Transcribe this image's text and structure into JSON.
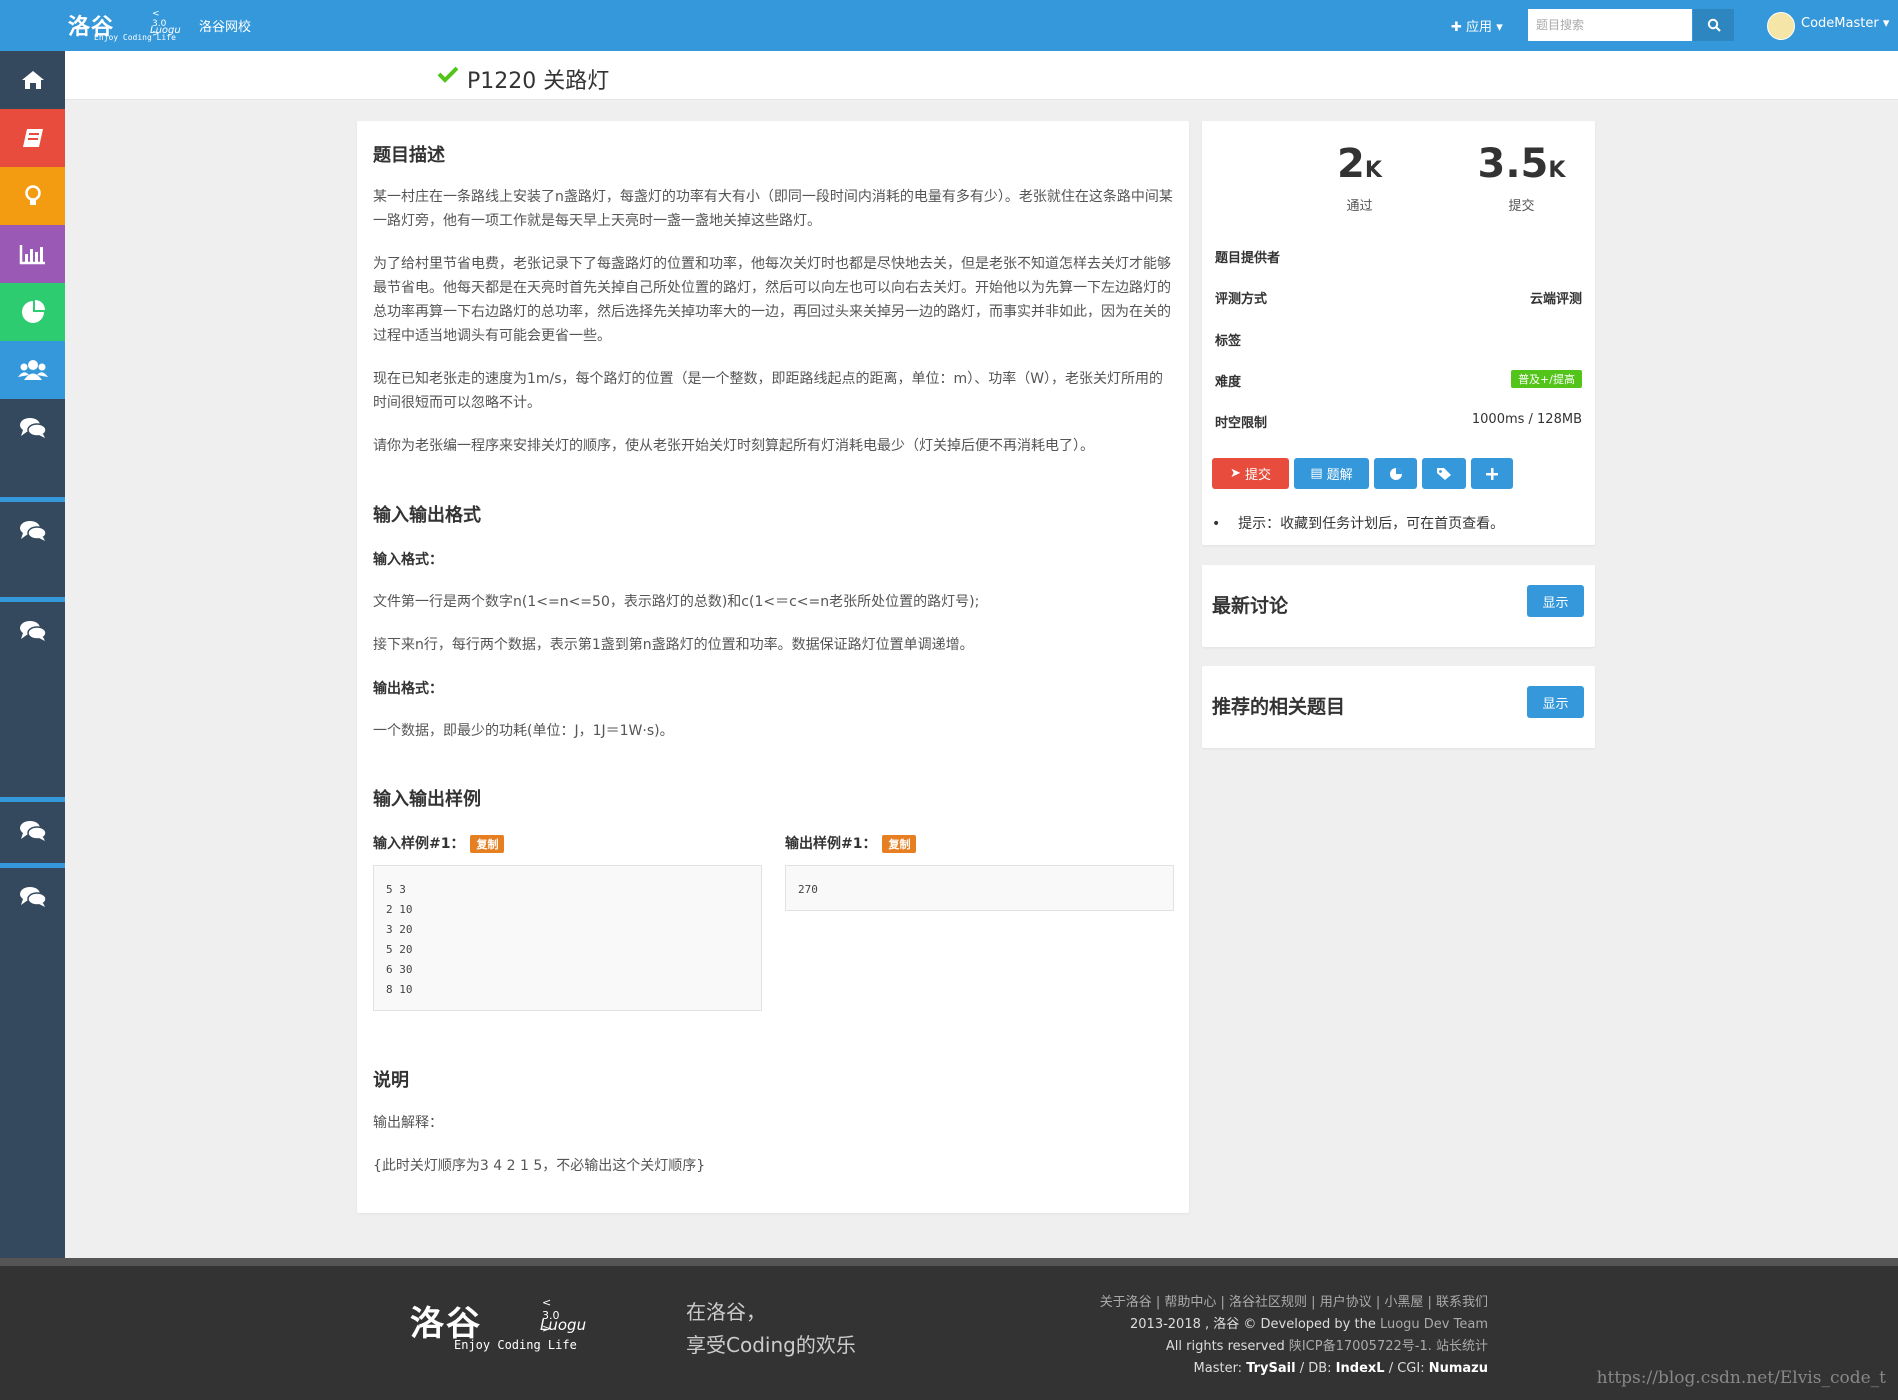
{
  "header": {
    "logo_text": "洛谷",
    "logo_version": "< 3.0 >",
    "logo_sub": "Luogu",
    "logo_tagline": "Enjoy Coding Life",
    "school_link": "洛谷网校",
    "apps_menu": "应用",
    "search_placeholder": "题目搜索",
    "username": "CodeMaster"
  },
  "sidebar": {
    "items": [
      {
        "icon": "home-icon",
        "color": "#34495e"
      },
      {
        "icon": "book-icon",
        "color": "#e74c3c"
      },
      {
        "icon": "lightbulb-icon",
        "color": "#f39c12"
      },
      {
        "icon": "bar-chart-icon",
        "color": "#9b59b6"
      },
      {
        "icon": "pie-chart-icon",
        "color": "#2ecc71"
      },
      {
        "icon": "users-icon",
        "color": "#3498db"
      },
      {
        "icon": "comments-icon",
        "color": "#34495e"
      },
      {
        "icon": "comments-icon",
        "color": "#34495e"
      },
      {
        "icon": "comments-icon",
        "color": "#34495e"
      },
      {
        "icon": "comments-icon",
        "color": "#34495e"
      },
      {
        "icon": "comments-icon",
        "color": "#34495e"
      }
    ]
  },
  "problem": {
    "title": "P1220 关路灯",
    "description_heading": "题目描述",
    "description": [
      "某一村庄在一条路线上安装了n盏路灯，每盏灯的功率有大有小（即同一段时间内消耗的电量有多有少）。老张就住在这条路中间某一路灯旁，他有一项工作就是每天早上天亮时一盏一盏地关掉这些路灯。",
      "为了给村里节省电费，老张记录下了每盏路灯的位置和功率，他每次关灯时也都是尽快地去关，但是老张不知道怎样去关灯才能够最节省电。他每天都是在天亮时首先关掉自己所处位置的路灯，然后可以向左也可以向右去关灯。开始他以为先算一下左边路灯的总功率再算一下右边路灯的总功率，然后选择先关掉功率大的一边，再回过头来关掉另一边的路灯，而事实并非如此，因为在关的过程中适当地调头有可能会更省一些。",
      "现在已知老张走的速度为1m/s，每个路灯的位置（是一个整数，即距路线起点的距离，单位：m）、功率（W），老张关灯所用的时间很短而可以忽略不计。",
      "请你为老张编一程序来安排关灯的顺序，使从老张开始关灯时刻算起所有灯消耗电最少（灯关掉后便不再消耗电了）。"
    ],
    "io_heading": "输入输出格式",
    "input_format_label": "输入格式：",
    "input_format": [
      "文件第一行是两个数字n(1<=n<=50，表示路灯的总数)和c(1<＝c<=n老张所处位置的路灯号);",
      "接下来n行，每行两个数据，表示第1盏到第n盏路灯的位置和功率。数据保证路灯位置单调递增。"
    ],
    "output_format_label": "输出格式：",
    "output_format": "一个数据，即最少的功耗(单位：J，1J＝1W·s)。",
    "samples_heading": "输入输出样例",
    "sample_input_label": "输入样例#1：",
    "sample_output_label": "输出样例#1：",
    "copy_label": "复制",
    "sample_input": "5 3\n2 10\n3 20\n5 20\n6 30\n8 10",
    "sample_output": "270",
    "notes_heading": "说明",
    "notes": [
      "输出解释：",
      "{此时关灯顺序为3 4 2 1 5，不必输出这个关灯顺序}"
    ]
  },
  "stats": {
    "passed_num": "2",
    "passed_unit": "K",
    "passed_label": "通过",
    "submitted_num": "3.5",
    "submitted_unit": "K",
    "submitted_label": "提交"
  },
  "info": {
    "provider_label": "题目提供者",
    "judge_label": "评测方式",
    "judge_value": "云端评测",
    "tags_label": "标签",
    "difficulty_label": "难度",
    "difficulty_value": "普及+/提高",
    "difficulty_color": "#52c41a",
    "limits_label": "时空限制",
    "limits_value": "1000ms / 128MB"
  },
  "actions": {
    "submit": "提交",
    "solutions": "题解",
    "tip": "提示：收藏到任务计划后，可在首页查看。"
  },
  "side_panels": {
    "discussions_heading": "最新讨论",
    "related_heading": "推荐的相关题目",
    "show_label": "显示"
  },
  "footer": {
    "logo_text": "洛谷",
    "logo_version": "< 3.0 >",
    "logo_sub": "Luogu",
    "logo_tagline": "Enjoy Coding Life",
    "slogan_line1": "在洛谷，",
    "slogan_line2": "享受Coding的欢乐",
    "links": "关于洛谷 | 帮助中心 | 洛谷社区规则 | 用户协议 | 小黑屋 | 联系我们",
    "copyright_prefix": "2013-2018 , 洛谷 © Developed by the ",
    "copyright_team": "Luogu Dev Team",
    "rights_prefix": "All rights reserved ",
    "icp": "陕ICP备17005722号-1. 站长统计",
    "master_line_prefix": "Master: ",
    "master": "TrySail",
    "db_prefix": " / DB: ",
    "db": "IndexL",
    "cgi_prefix": " / CGI: ",
    "cgi": "Numazu"
  },
  "watermark": "https://blog.csdn.net/Elvis_code_t"
}
